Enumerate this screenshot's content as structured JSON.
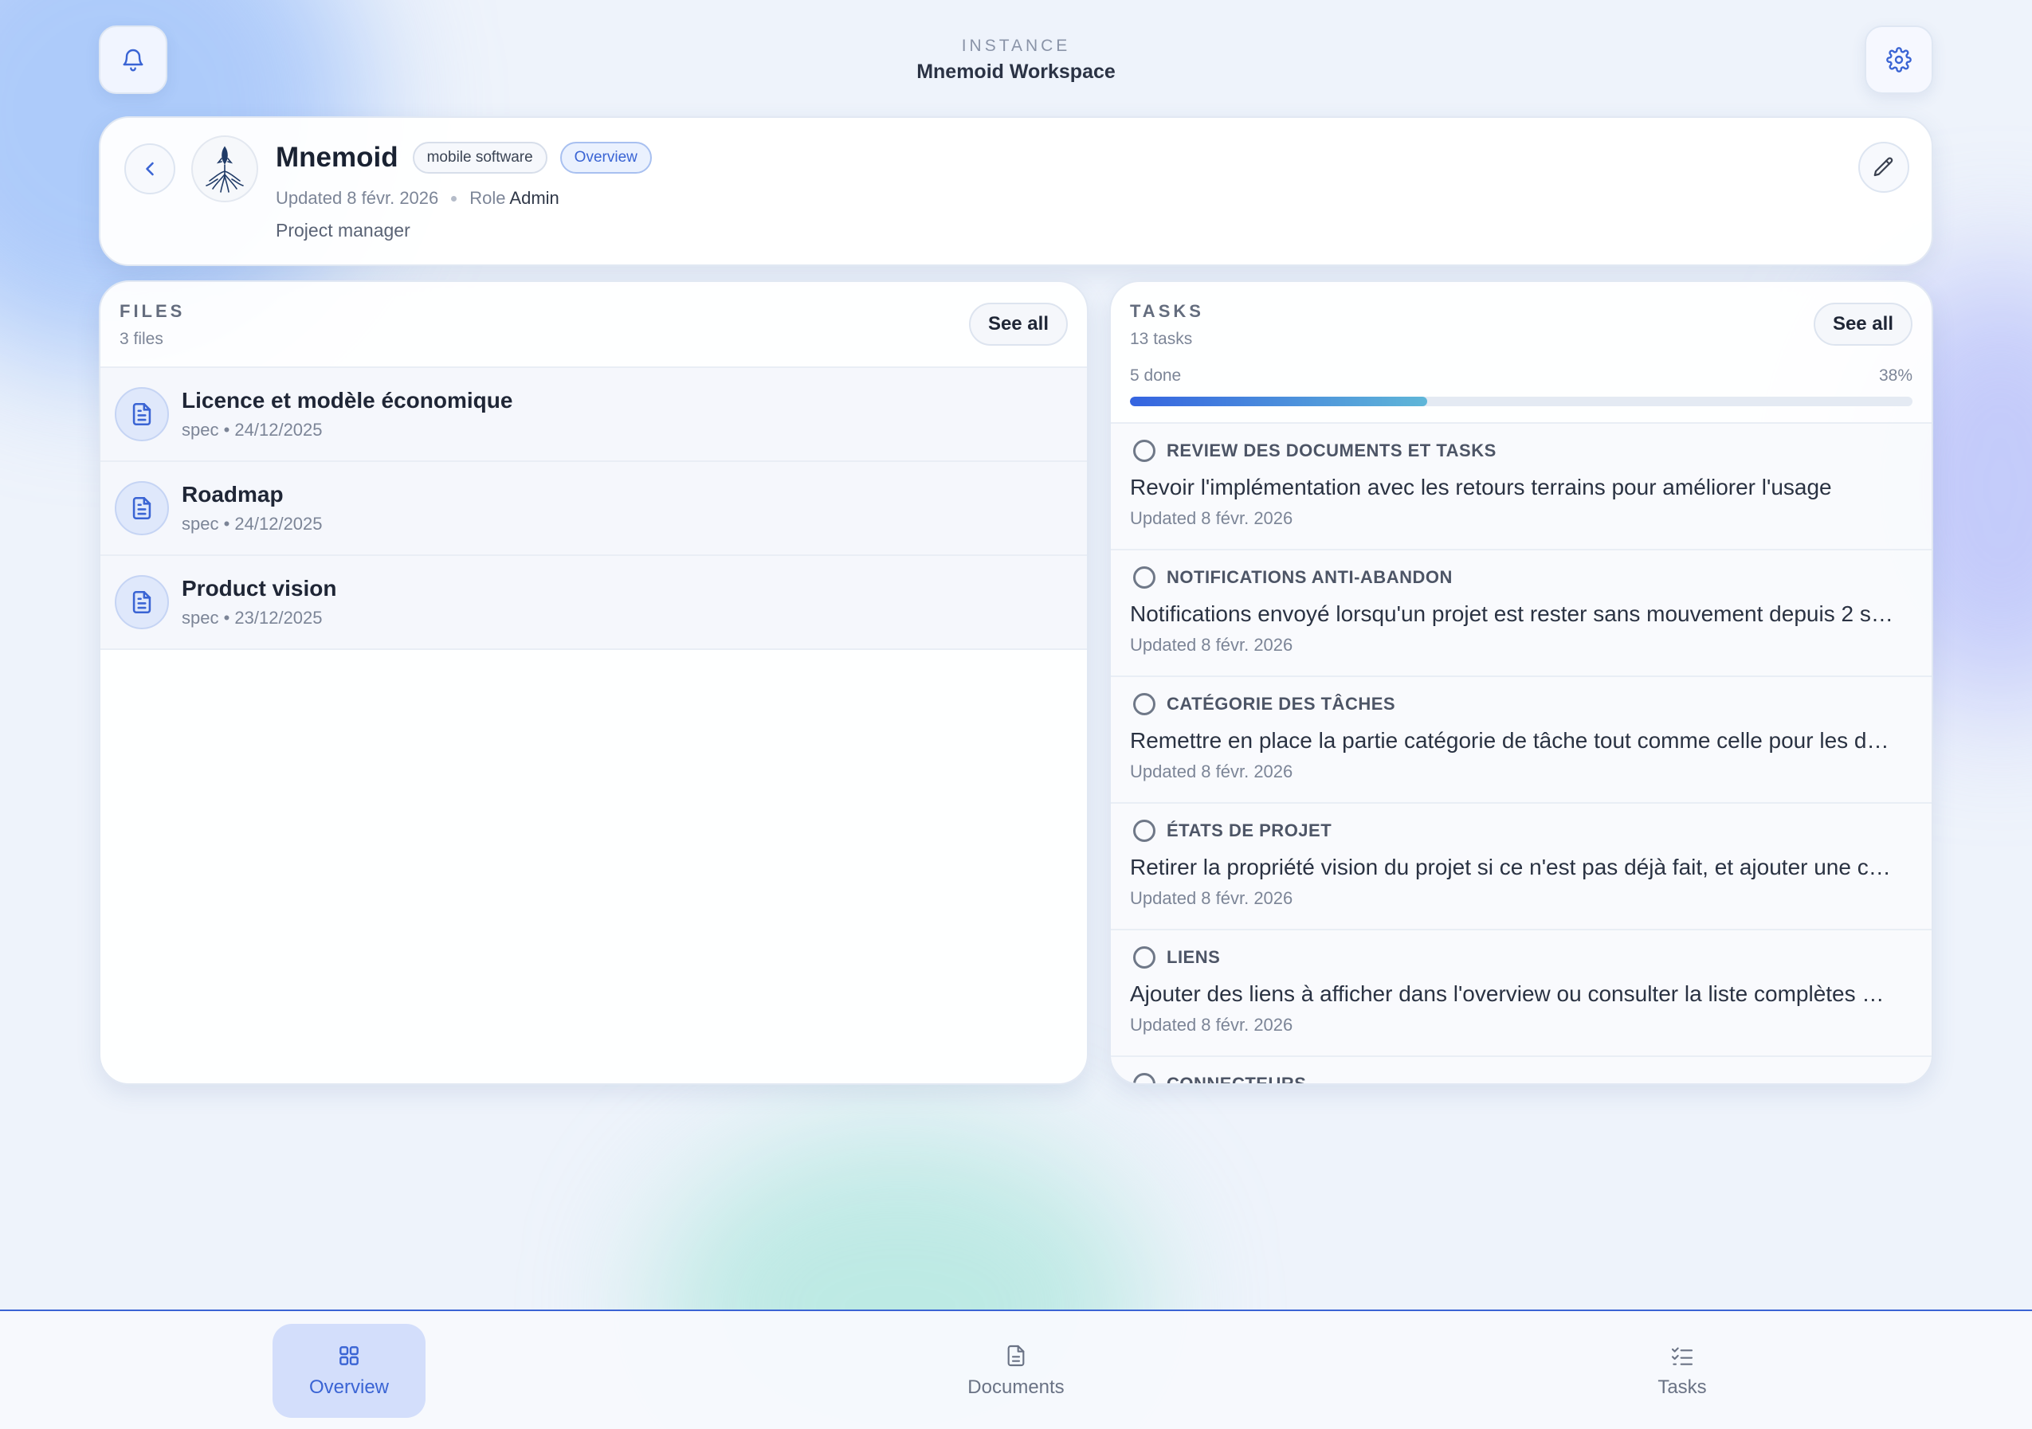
{
  "instance": {
    "label": "INSTANCE",
    "name": "Mnemoid Workspace"
  },
  "project": {
    "name": "Mnemoid",
    "tags": [
      "mobile software",
      "Overview"
    ],
    "updated": "Updated 8 févr. 2026",
    "role_label": "Role",
    "role_value": "Admin",
    "position": "Project manager"
  },
  "files": {
    "title": "FILES",
    "count": "3 files",
    "see_all": "See all",
    "items": [
      {
        "name": "Licence et modèle économique",
        "meta": "spec • 24/12/2025"
      },
      {
        "name": "Roadmap",
        "meta": "spec • 24/12/2025"
      },
      {
        "name": "Product vision",
        "meta": "spec • 23/12/2025"
      }
    ]
  },
  "tasks": {
    "title": "TASKS",
    "count": "13 tasks",
    "see_all": "See all",
    "done_label": "5 done",
    "percent_label": "38%",
    "progress_fraction": 0.38,
    "items": [
      {
        "title": "REVIEW DES DOCUMENTS ET TASKS",
        "desc": "Revoir l'implémentation avec les retours terrains pour améliorer l'usage",
        "updated": "Updated 8 févr. 2026"
      },
      {
        "title": "NOTIFICATIONS ANTI-ABANDON",
        "desc": "Notifications envoyé lorsqu'un projet est rester sans mouvement depuis 2 s…",
        "updated": "Updated 8 févr. 2026"
      },
      {
        "title": "CATÉGORIE DES TÂCHES",
        "desc": "Remettre en place la partie catégorie de tâche tout comme celle pour les d…",
        "updated": "Updated 8 févr. 2026"
      },
      {
        "title": "ÉTATS DE PROJET",
        "desc": "Retirer la propriété vision du projet si ce n'est pas déjà fait, et ajouter une c…",
        "updated": "Updated 8 févr. 2026"
      },
      {
        "title": "LIENS",
        "desc": "Ajouter des liens à afficher dans l'overview ou consulter la liste complètes …",
        "updated": "Updated 8 févr. 2026"
      },
      {
        "title": "CONNECTEURS",
        "desc": "",
        "updated": ""
      }
    ]
  },
  "nav": {
    "overview": "Overview",
    "documents": "Documents",
    "tasks": "Tasks"
  },
  "colors": {
    "accent": "#3a64d4",
    "background": "#eef3fb"
  }
}
